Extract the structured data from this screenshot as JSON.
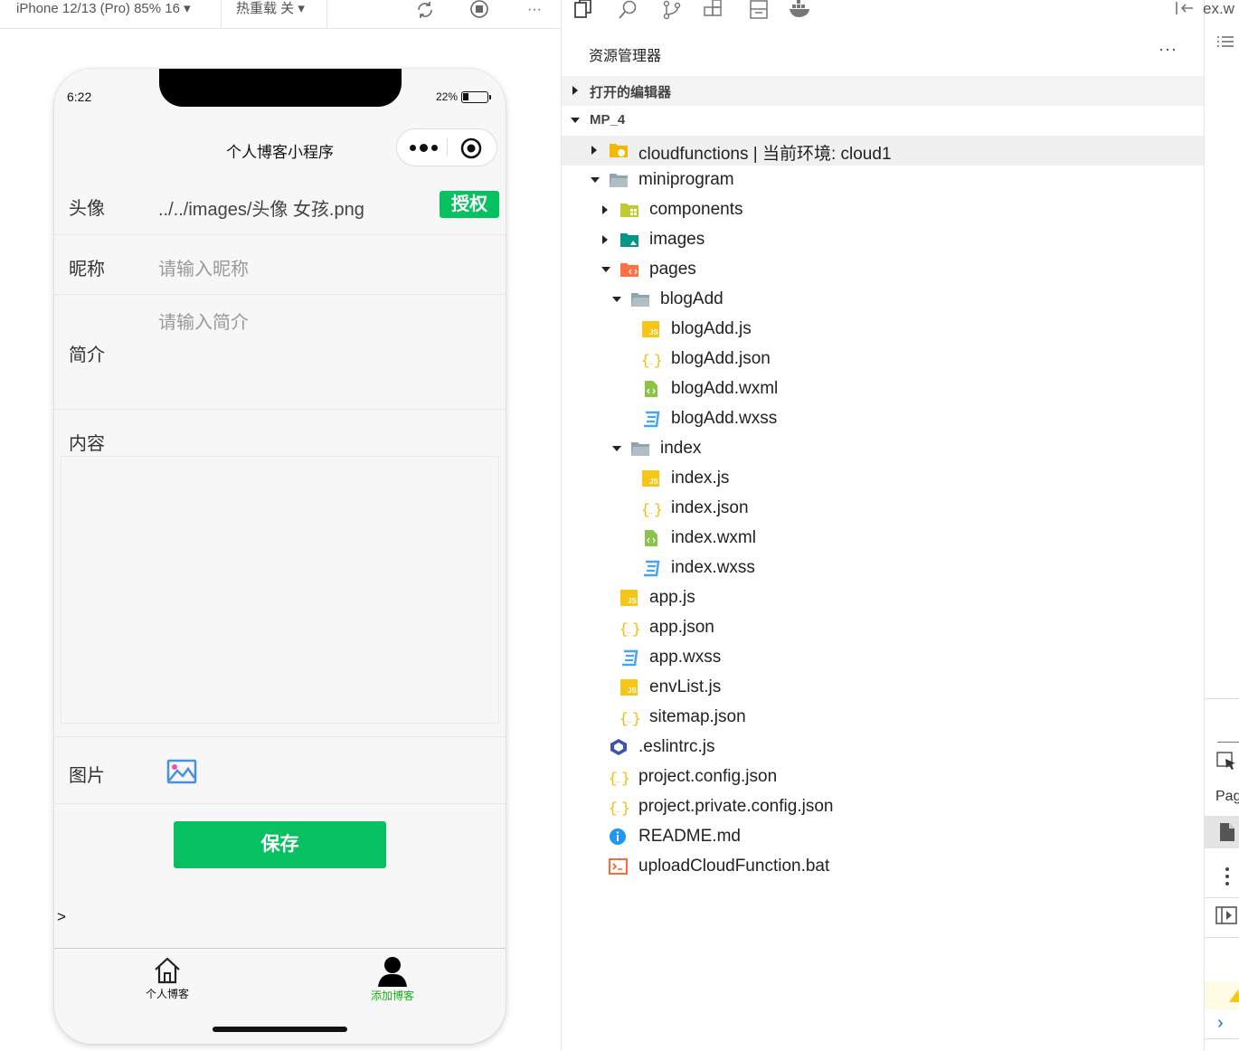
{
  "sim_toolbar": {
    "device": "iPhone 12/13 (Pro) 85% 16 ▾",
    "hot_reload": "热重载 关 ▾"
  },
  "phone": {
    "time": "6:22",
    "battery": "22%",
    "nav_title": "个人博客小程序",
    "form": {
      "avatar_label": "头像",
      "avatar_value": "../../images/头像 女孩.png",
      "auth_button": "授权",
      "nickname_label": "昵称",
      "nickname_placeholder": "请输入昵称",
      "intro_label": "简介",
      "intro_placeholder": "请输入简介",
      "content_label": "内容",
      "image_label": "图片",
      "save_button": "保存"
    },
    "chevron": ">",
    "tabs": [
      {
        "label": "个人博客",
        "active": false
      },
      {
        "label": "添加博客",
        "active": true
      }
    ],
    "colors": {
      "accent": "#07c160",
      "tab_active": "#1aad19"
    }
  },
  "explorer": {
    "title": "资源管理器",
    "more": "···",
    "open_editors": "打开的编辑器",
    "project": "MP_4",
    "tree": [
      {
        "name": "cloudfunctions | 当前环境: cloud1",
        "depth": 0,
        "arrow": "right",
        "icon": "folder-cloud-icon",
        "highlight": true
      },
      {
        "name": "miniprogram",
        "depth": 0,
        "arrow": "down",
        "icon": "folder-open-icon"
      },
      {
        "name": "components",
        "depth": 1,
        "arrow": "right",
        "icon": "folder-components-icon"
      },
      {
        "name": "images",
        "depth": 1,
        "arrow": "right",
        "icon": "folder-images-icon"
      },
      {
        "name": "pages",
        "depth": 1,
        "arrow": "down",
        "icon": "folder-pages-icon"
      },
      {
        "name": "blogAdd",
        "depth": 2,
        "arrow": "down",
        "icon": "folder-open-icon"
      },
      {
        "name": "blogAdd.js",
        "depth": 3,
        "icon": "js-file-icon"
      },
      {
        "name": "blogAdd.json",
        "depth": 3,
        "icon": "json-file-icon"
      },
      {
        "name": "blogAdd.wxml",
        "depth": 3,
        "icon": "wxml-file-icon"
      },
      {
        "name": "blogAdd.wxss",
        "depth": 3,
        "icon": "wxss-file-icon"
      },
      {
        "name": "index",
        "depth": 2,
        "arrow": "down",
        "icon": "folder-open-icon"
      },
      {
        "name": "index.js",
        "depth": 3,
        "icon": "js-file-icon"
      },
      {
        "name": "index.json",
        "depth": 3,
        "icon": "json-file-icon"
      },
      {
        "name": "index.wxml",
        "depth": 3,
        "icon": "wxml-file-icon"
      },
      {
        "name": "index.wxss",
        "depth": 3,
        "icon": "wxss-file-icon"
      },
      {
        "name": "app.js",
        "depth": 1,
        "icon": "js-file-icon"
      },
      {
        "name": "app.json",
        "depth": 1,
        "icon": "json-file-icon"
      },
      {
        "name": "app.wxss",
        "depth": 1,
        "icon": "wxss-file-icon"
      },
      {
        "name": "envList.js",
        "depth": 1,
        "icon": "js-file-icon"
      },
      {
        "name": "sitemap.json",
        "depth": 1,
        "icon": "json-file-icon"
      },
      {
        "name": ".eslintrc.js",
        "depth": 0,
        "icon": "eslint-file-icon"
      },
      {
        "name": "project.config.json",
        "depth": 0,
        "icon": "json-file-icon"
      },
      {
        "name": "project.private.config.json",
        "depth": 0,
        "icon": "json-file-icon"
      },
      {
        "name": "README.md",
        "depth": 0,
        "icon": "info-file-icon"
      },
      {
        "name": "uploadCloudFunction.bat",
        "depth": 0,
        "icon": "bat-file-icon"
      }
    ]
  },
  "debug_strip": {
    "tab_text": "ex.w",
    "pag": "Pag",
    "chevron": "›"
  }
}
